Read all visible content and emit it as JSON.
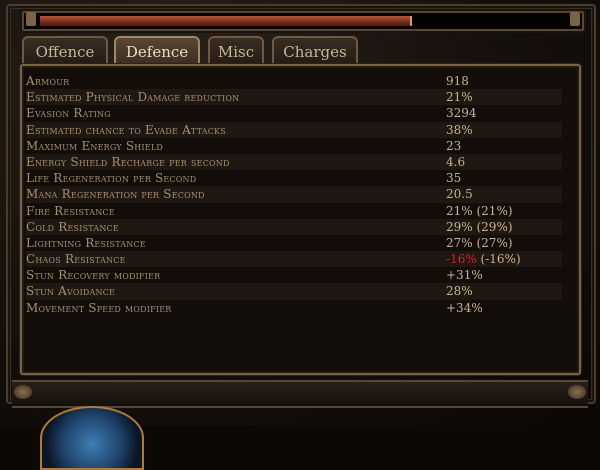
{
  "xp_bar": {
    "progress": 0.7
  },
  "tabs": [
    {
      "label": "Offence",
      "active": false
    },
    {
      "label": "Defence",
      "active": true
    },
    {
      "label": "Misc",
      "active": false
    },
    {
      "label": "Charges",
      "active": false
    }
  ],
  "stats": [
    {
      "label": "Armour",
      "value": "918"
    },
    {
      "label": "Estimated Physical Damage reduction",
      "value": "21%"
    },
    {
      "label": "Evasion Rating",
      "value": "3294"
    },
    {
      "label": "Estimated chance to Evade Attacks",
      "value": "38%"
    },
    {
      "label": "Maximum Energy Shield",
      "value": "23"
    },
    {
      "label": "Energy Shield Recharge per second",
      "value": "4.6"
    },
    {
      "label": "Life Regeneration per Second",
      "value": "35"
    },
    {
      "label": "Mana Regeneration per Second",
      "value": "20.5"
    },
    {
      "label": "Fire Resistance",
      "value": "21% (21%)"
    },
    {
      "label": "Cold Resistance",
      "value": "29% (29%)"
    },
    {
      "label": "Lightning Resistance",
      "value": "27% (27%)"
    },
    {
      "label": "Chaos Resistance",
      "value_neg": "-16%",
      "value_rest": " (-16%)"
    },
    {
      "label": "Stun Recovery modifier",
      "value": "+31%"
    },
    {
      "label": "Stun Avoidance",
      "value": "28%"
    },
    {
      "label": "Movement Speed modifier",
      "value": "+34%"
    }
  ],
  "colors": {
    "negative": "#e02020",
    "label": "#a89070",
    "value": "#c9b28f"
  }
}
